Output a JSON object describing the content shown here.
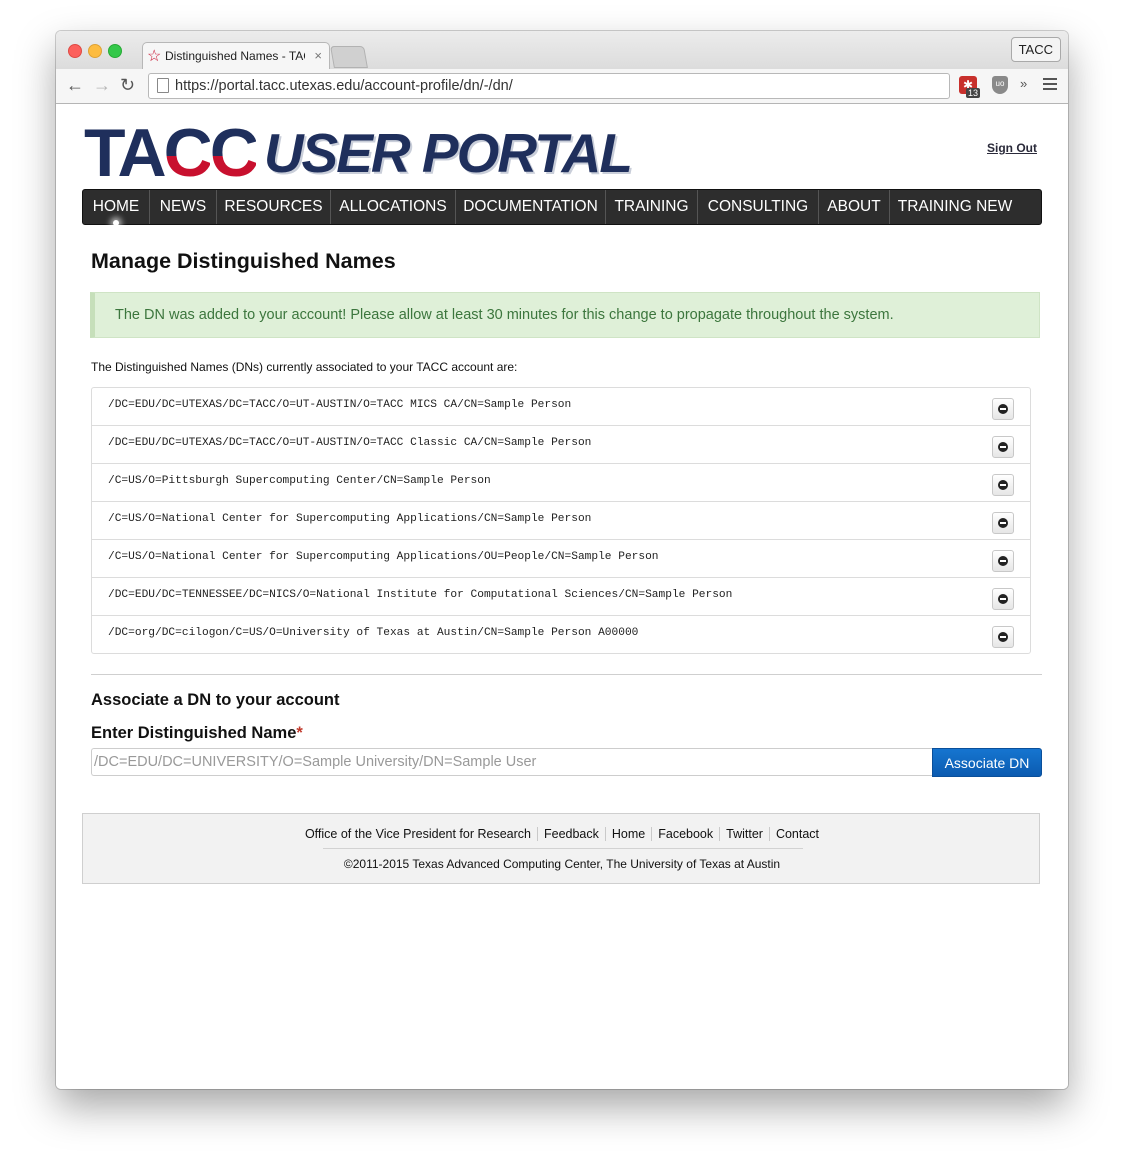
{
  "browser": {
    "tab_title": "Distinguished Names - TACC",
    "tab_close": "×",
    "profile_name": "TACC",
    "url": "https://portal.tacc.utexas.edu/account-profile/dn/-/dn/",
    "extension_badge": "13",
    "extension_shield_label": "uo",
    "more_label": "»"
  },
  "header": {
    "logo_left": "TA",
    "logo_c1": "C",
    "logo_c2": "C",
    "logo_right": "USER PORTAL",
    "sign_out": "Sign Out"
  },
  "nav": {
    "items": [
      {
        "label": "HOME"
      },
      {
        "label": "NEWS"
      },
      {
        "label": "RESOURCES"
      },
      {
        "label": "ALLOCATIONS"
      },
      {
        "label": "DOCUMENTATION"
      },
      {
        "label": "TRAINING"
      },
      {
        "label": "CONSULTING"
      },
      {
        "label": "ABOUT"
      },
      {
        "label": "TRAINING NEW"
      }
    ]
  },
  "main": {
    "title": "Manage Distinguished Names",
    "alert": "The DN was added to your account! Please allow at least 30 minutes for this change to propagate throughout the system.",
    "intro": "The Distinguished Names (DNs) currently associated to your TACC account are:",
    "dns": [
      "/DC=EDU/DC=UTEXAS/DC=TACC/O=UT-AUSTIN/O=TACC MICS CA/CN=Sample Person",
      "/DC=EDU/DC=UTEXAS/DC=TACC/O=UT-AUSTIN/O=TACC Classic CA/CN=Sample Person",
      "/C=US/O=Pittsburgh Supercomputing Center/CN=Sample Person",
      "/C=US/O=National Center for Supercomputing Applications/CN=Sample Person",
      "/C=US/O=National Center for Supercomputing Applications/OU=People/CN=Sample Person",
      "/DC=EDU/DC=TENNESSEE/DC=NICS/O=National Institute for Computational Sciences/CN=Sample Person",
      "/DC=org/DC=cilogon/C=US/O=University of Texas at Austin/CN=Sample Person A00000"
    ],
    "associate_heading": "Associate a DN to your account",
    "field_label": "Enter Distinguished Name",
    "required_mark": "*",
    "field_placeholder": "/DC=EDU/DC=UNIVERSITY/O=Sample University/DN=Sample User",
    "field_value": "",
    "submit_label": "Associate DN"
  },
  "footer": {
    "links": [
      "Office of the Vice President for Research",
      "Feedback",
      "Home",
      "Facebook",
      "Twitter",
      "Contact"
    ],
    "copyright": "©2011-2015 Texas Advanced Computing Center, The University of Texas at Austin"
  }
}
